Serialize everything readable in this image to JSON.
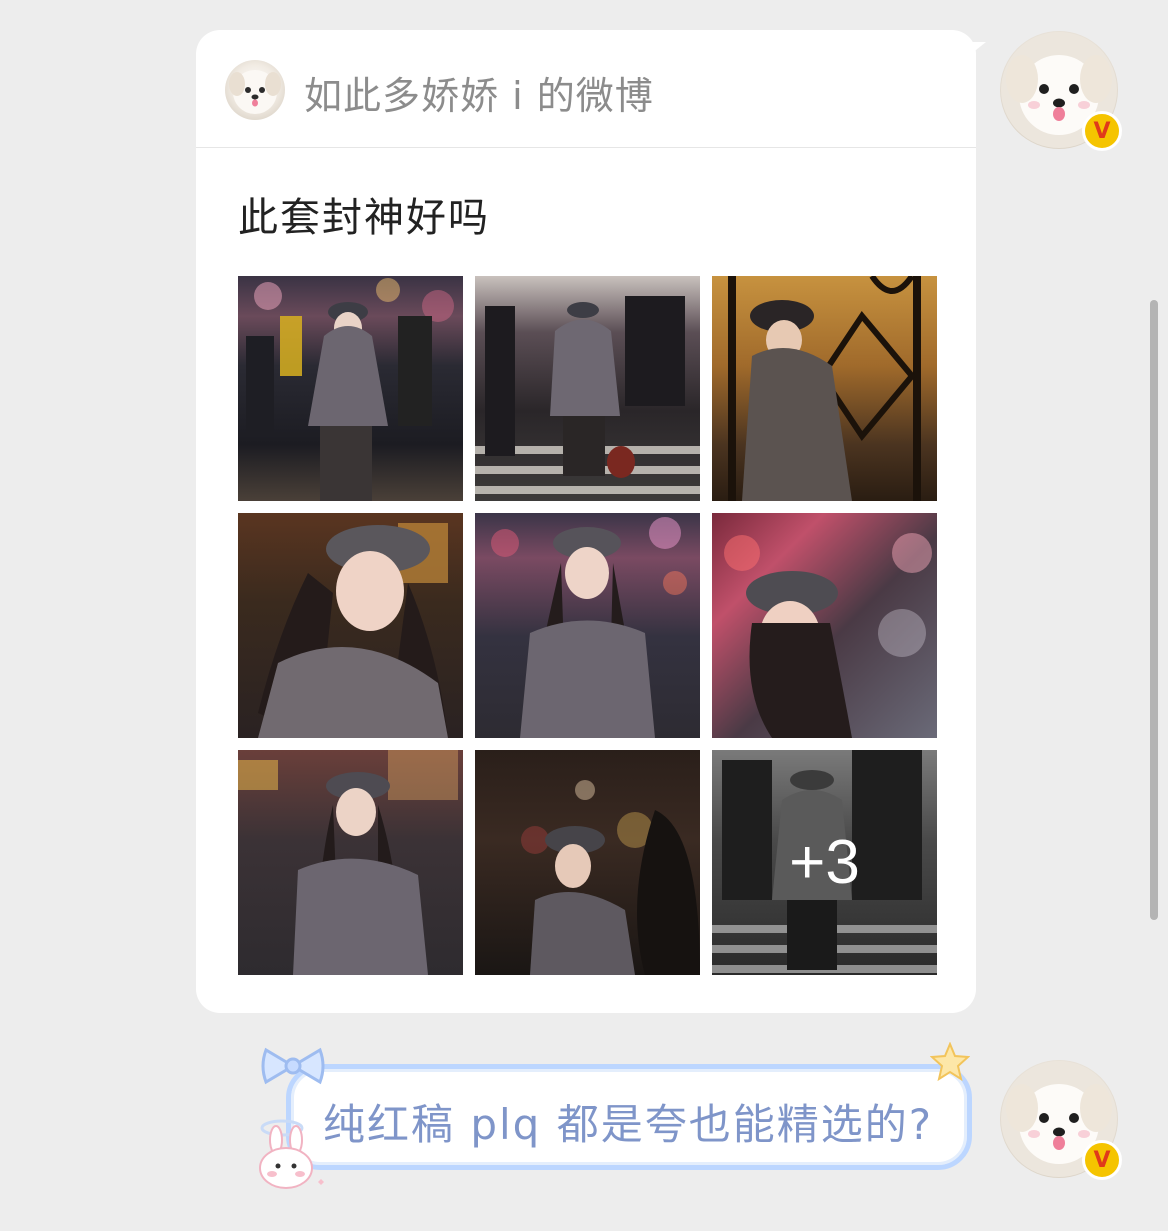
{
  "card": {
    "source_name": "如此多娇娇 i 的微博",
    "post_text": "此套封神好吗",
    "photos": [
      {
        "id": "p1"
      },
      {
        "id": "p2"
      },
      {
        "id": "p3"
      },
      {
        "id": "p4"
      },
      {
        "id": "p5"
      },
      {
        "id": "p6"
      },
      {
        "id": "p7"
      },
      {
        "id": "p8"
      },
      {
        "id": "p9"
      }
    ],
    "more_count": "+3"
  },
  "reply": {
    "text": "纯红稿 plq 都是夸也能精选的?"
  },
  "badge": {
    "text": "V",
    "color": "#f5c400"
  },
  "icons": [
    "avatar-dog-icon",
    "verified-badge-icon",
    "bow-sticker-icon",
    "star-sticker-icon",
    "bunny-sticker-icon"
  ]
}
